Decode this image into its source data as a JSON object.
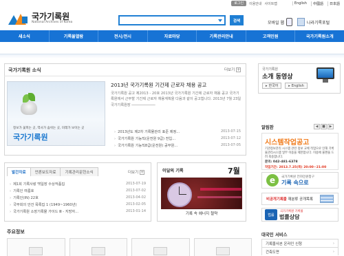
{
  "util": {
    "login": "로그인",
    "links": [
      "이용안내",
      "사이트맵"
    ],
    "langs": [
      "English",
      "中國語",
      "日本語"
    ]
  },
  "logo": {
    "ko": "국가기록원",
    "en": "National Archives of Korea"
  },
  "search": {
    "button": "검색",
    "placeholder": ""
  },
  "quick": {
    "mobile": "모바일 웹",
    "portal": "나라기록포털"
  },
  "nav": [
    "새소식",
    "기록물열람",
    "전시/전시",
    "자료마당",
    "기록관리안내",
    "고객민원",
    "국가기록원소개"
  ],
  "news": {
    "title": "국가기록원 소식",
    "more": "더보기",
    "slogan": "정보가 꽃피는 곳, 역사가 숨쉬는 곳, 미래가 보이는 곳",
    "brand": "국가기록원",
    "headline": "2013년 국가기록원 기간제 근로자 채용 공고",
    "body": "국가기록원 공고 제2013 - 20호 2013년 국가기록원 기간제 근로자 채용 공고 국가기록원에서 근무할 기간제 근로자 채용계획을 다음과 같이 공고합니다. 2013년 7월 23일 국가기록원장 ───────────",
    "items": [
      {
        "text": "2013년도 제2차 기록물관리 표준 제정...",
        "date": "2013-07-15"
      },
      {
        "text": "국가기록원 기능직(운전원 9급) 전입...",
        "date": "2013-07-12"
      },
      {
        "text": "국가기록원 기능직8급(운전원) 공무원...",
        "date": "2013-07-05"
      }
    ]
  },
  "tabs": {
    "labels": [
      "발간자료",
      "언론보도자료",
      "기록관리문헌소식"
    ],
    "more": "더보기",
    "items": [
      {
        "text": "제1회 기록사랑 백일장 수상작품집",
        "date": "2013-07-19"
      },
      {
        "text": "기록인 여름호",
        "date": "2013-07-02"
      },
      {
        "text": "기록인(IN) 22호",
        "date": "2013-04-02"
      },
      {
        "text": "국무회의 안건 목록집 1 (1949~1960년)",
        "date": "2013-02-05"
      },
      {
        "text": "국가기록원 소장기록물 가이드 Ⅲ - 지방자...",
        "date": "2013-01-14"
      }
    ]
  },
  "record": {
    "title": "이달의 기록",
    "month": "7월",
    "caption": "기록 속 에너지 절약"
  },
  "main_info": "주요정보",
  "pr": {
    "sub": "국가기록원",
    "title": "소개 동영상",
    "korean": "한국어",
    "english": "English"
  },
  "notice": {
    "title": "알림판",
    "pager": [
      "◀",
      "■",
      "▶"
    ],
    "big": "시스템작업공고",
    "desc": "기관정보관리 시스템 관련 정보 교체 작업으로 인해 기록물관리시스템 일부 이용을 제한합니다. 이용에 불편을 드려 죄송합니다.",
    "phone": "문의: 042-481-6378",
    "period": "작업기간: 2013.7.25(목) 20:00~21:00"
  },
  "banner1": {
    "e": "e",
    "sub": "국가기록원 전자민원창구",
    "main": "기록 속으로"
  },
  "banner2": {
    "text1": "비공개기록물",
    "text2": " 재분류 공개목록"
  },
  "banner3": {
    "badge": "법률",
    "sub": "국가기록원 기록물",
    "main": "법률상담"
  },
  "services": {
    "title": "대국민 서비스",
    "items": [
      "기록물사본 온라인 신청",
      "건축도면"
    ]
  }
}
